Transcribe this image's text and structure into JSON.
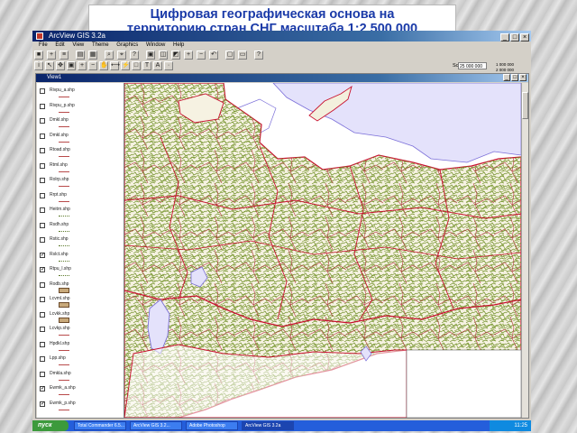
{
  "slide": {
    "title_line1": "Цифровая географическая основа на",
    "title_line2": "территорию стран СНГ масштаба 1:2 500 000"
  },
  "app": {
    "title": "ArcView GIS 3.2a",
    "menu": [
      "File",
      "Edit",
      "View",
      "Theme",
      "Graphics",
      "Window",
      "Help"
    ]
  },
  "toolbar": {
    "scale_label": "Scale 1:",
    "scale_value": "25 000 000",
    "coord_x": "1 000 000",
    "coord_y": "2 000 000"
  },
  "view": {
    "title": "View1",
    "themes": [
      {
        "label": "Rivpu_a.shp",
        "checked": false,
        "sym": "line"
      },
      {
        "label": "Rivpu_p.shp",
        "checked": false,
        "sym": "line"
      },
      {
        "label": "Dmkl.shp",
        "checked": false,
        "sym": "line"
      },
      {
        "label": "Dmkl.shp",
        "checked": false,
        "sym": "line"
      },
      {
        "label": "Rtoad.shp",
        "checked": false,
        "sym": "line"
      },
      {
        "label": "Rtml.shp",
        "checked": false,
        "sym": "line"
      },
      {
        "label": "Rolrp.shp",
        "checked": false,
        "sym": "line"
      },
      {
        "label": "Rrpt.shp",
        "checked": false,
        "sym": "line"
      },
      {
        "label": "Heitrn.shp",
        "checked": false,
        "sym": "wave"
      },
      {
        "label": "Rsdh.shp",
        "checked": false,
        "sym": "wave"
      },
      {
        "label": "Rstic.shp",
        "checked": false,
        "sym": "wave"
      },
      {
        "label": "Rslct.shp",
        "checked": true,
        "sym": "wave"
      },
      {
        "label": "Rtpu_l.shp",
        "checked": true,
        "sym": "wave"
      },
      {
        "label": "Rodb.shp",
        "checked": false,
        "sym": "fill"
      },
      {
        "label": "Lcvml.shp",
        "checked": false,
        "sym": "fill"
      },
      {
        "label": "Lcvkk.shp",
        "checked": false,
        "sym": "fill"
      },
      {
        "label": "Lcvkp.shp",
        "checked": false,
        "sym": "line"
      },
      {
        "label": "Hpdkl.shp",
        "checked": false,
        "sym": "line"
      },
      {
        "label": "Lpp.shp",
        "checked": false,
        "sym": "line"
      },
      {
        "label": "Dmkla.shp",
        "checked": false,
        "sym": "line"
      },
      {
        "label": "Ewmk_a.shp",
        "checked": true,
        "sym": "line"
      },
      {
        "label": "Ewmk_p.shp",
        "checked": true,
        "sym": "line"
      }
    ]
  },
  "taskbar": {
    "start": "пуск",
    "items": [
      "Total Commander 6.5...",
      "ArcView GIS 3.2...",
      "Adobe Photoshop",
      "ArcView GIS 3.2a"
    ],
    "clock": "11:25"
  },
  "colors": {
    "title_text": "#1a3aa8",
    "border": "#c8102e",
    "rivers": "#6b8c21",
    "water": "#7b6fd9",
    "titlebar": "#0a246a"
  }
}
